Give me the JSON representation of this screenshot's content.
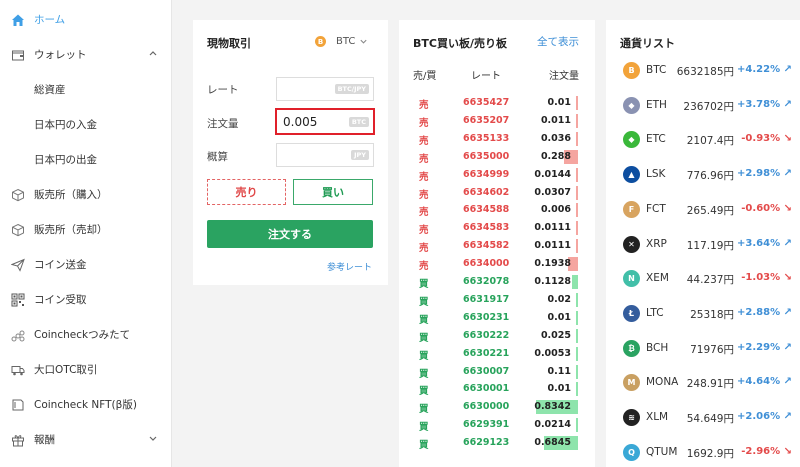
{
  "sidebar": {
    "items": [
      {
        "label": "ホーム",
        "icon": "home-icon"
      },
      {
        "label": "ウォレット",
        "icon": "wallet-icon"
      },
      {
        "label": "総資産"
      },
      {
        "label": "日本円の入金"
      },
      {
        "label": "日本円の出金"
      },
      {
        "label": "販売所（購入）",
        "icon": "cube-icon"
      },
      {
        "label": "販売所（売却）",
        "icon": "cube-icon"
      },
      {
        "label": "コイン送金",
        "icon": "send-icon"
      },
      {
        "label": "コイン受取",
        "icon": "qr-icon"
      },
      {
        "label": "Coincheckつみたて",
        "icon": "coins-icon"
      },
      {
        "label": "大口OTC取引",
        "icon": "truck-icon"
      },
      {
        "label": "Coincheck NFT(β版)",
        "icon": "nft-icon"
      },
      {
        "label": "報酬",
        "icon": "gift-icon"
      }
    ]
  },
  "trade": {
    "title": "現物取引",
    "coin": "BTC",
    "coin_icon_label": "B",
    "rate_label": "レート",
    "rate_unit": "BTC/JPY",
    "qty_label": "注文量",
    "qty_value": "0.005",
    "qty_unit": "BTC",
    "est_label": "概算",
    "est_unit": "JPY",
    "sell_label": "売り",
    "buy_label": "買い",
    "order_label": "注文する",
    "ref_rate": "参考レート"
  },
  "book": {
    "title": "BTC買い板/売り板",
    "see_all": "全て表示",
    "col_side": "売/買",
    "col_rate": "レート",
    "col_amount": "注文量",
    "rows": [
      {
        "side": "売",
        "type": "sell",
        "price": "6635427",
        "amount": "0.01",
        "depth": 0.01
      },
      {
        "side": "売",
        "type": "sell",
        "price": "6635207",
        "amount": "0.011",
        "depth": 0.01
      },
      {
        "side": "売",
        "type": "sell",
        "price": "6635133",
        "amount": "0.036",
        "depth": 0.01
      },
      {
        "side": "売",
        "type": "sell",
        "price": "6635000",
        "amount": "0.288",
        "depth": 0.29
      },
      {
        "side": "売",
        "type": "sell",
        "price": "6634999",
        "amount": "0.0144",
        "depth": 0.01
      },
      {
        "side": "売",
        "type": "sell",
        "price": "6634602",
        "amount": "0.0307",
        "depth": 0.01
      },
      {
        "side": "売",
        "type": "sell",
        "price": "6634588",
        "amount": "0.006",
        "depth": 0.01
      },
      {
        "side": "売",
        "type": "sell",
        "price": "6634583",
        "amount": "0.0111",
        "depth": 0.01
      },
      {
        "side": "売",
        "type": "sell",
        "price": "6634582",
        "amount": "0.0111",
        "depth": 0.01
      },
      {
        "side": "売",
        "type": "sell",
        "price": "6634000",
        "amount": "0.1938",
        "depth": 0.19
      },
      {
        "side": "買",
        "type": "buy",
        "price": "6632078",
        "amount": "0.1128",
        "depth": 0.11
      },
      {
        "side": "買",
        "type": "buy",
        "price": "6631917",
        "amount": "0.02",
        "depth": 0.02
      },
      {
        "side": "買",
        "type": "buy",
        "price": "6630231",
        "amount": "0.01",
        "depth": 0.01
      },
      {
        "side": "買",
        "type": "buy",
        "price": "6630222",
        "amount": "0.025",
        "depth": 0.02
      },
      {
        "side": "買",
        "type": "buy",
        "price": "6630221",
        "amount": "0.0053",
        "depth": 0.01
      },
      {
        "side": "買",
        "type": "buy",
        "price": "6630007",
        "amount": "0.11",
        "depth": 0.03
      },
      {
        "side": "買",
        "type": "buy",
        "price": "6630001",
        "amount": "0.01",
        "depth": 0.01
      },
      {
        "side": "買",
        "type": "buy",
        "price": "6630000",
        "amount": "0.8342",
        "depth": 0.83
      },
      {
        "side": "買",
        "type": "buy",
        "price": "6629391",
        "amount": "0.0214",
        "depth": 0.02
      },
      {
        "side": "買",
        "type": "buy",
        "price": "6629123",
        "amount": "0.6845",
        "depth": 0.68
      }
    ]
  },
  "coins": {
    "title": "通貨リスト",
    "items": [
      {
        "symbol": "BTC",
        "price": "6632185円",
        "change": "+4.22%",
        "dir": "up",
        "color": "#f2a33a",
        "glyph": "B"
      },
      {
        "symbol": "ETH",
        "price": "236702円",
        "change": "+3.78%",
        "dir": "up",
        "color": "#8a92b2",
        "glyph": "◆"
      },
      {
        "symbol": "ETC",
        "price": "2107.4円",
        "change": "-0.93%",
        "dir": "down",
        "color": "#3ab83a",
        "glyph": "◆"
      },
      {
        "symbol": "LSK",
        "price": "776.96円",
        "change": "+2.98%",
        "dir": "up",
        "color": "#0d4ea0",
        "glyph": "▲"
      },
      {
        "symbol": "FCT",
        "price": "265.49円",
        "change": "-0.60%",
        "dir": "down",
        "color": "#d8a460",
        "glyph": "F"
      },
      {
        "symbol": "XRP",
        "price": "117.19円",
        "change": "+3.64%",
        "dir": "up",
        "color": "#222222",
        "glyph": "✕"
      },
      {
        "symbol": "XEM",
        "price": "44.237円",
        "change": "-1.03%",
        "dir": "down",
        "color": "#41bfa8",
        "glyph": "N"
      },
      {
        "symbol": "LTC",
        "price": "25318円",
        "change": "+2.88%",
        "dir": "up",
        "color": "#345d9d",
        "glyph": "Ł"
      },
      {
        "symbol": "BCH",
        "price": "71976円",
        "change": "+2.29%",
        "dir": "up",
        "color": "#2aa361",
        "glyph": "₿"
      },
      {
        "symbol": "MONA",
        "price": "248.91円",
        "change": "+4.64%",
        "dir": "up",
        "color": "#c9a062",
        "glyph": "M"
      },
      {
        "symbol": "XLM",
        "price": "54.649円",
        "change": "+2.06%",
        "dir": "up",
        "color": "#222222",
        "glyph": "≋"
      },
      {
        "symbol": "QTUM",
        "price": "1692.9円",
        "change": "-2.96%",
        "dir": "down",
        "color": "#3aa8d6",
        "glyph": "Q"
      }
    ]
  },
  "colors": {
    "accent": "#3f9fe6",
    "buy": "#27a35b",
    "sell": "#e34a4a",
    "focus_border": "#e0202a"
  }
}
